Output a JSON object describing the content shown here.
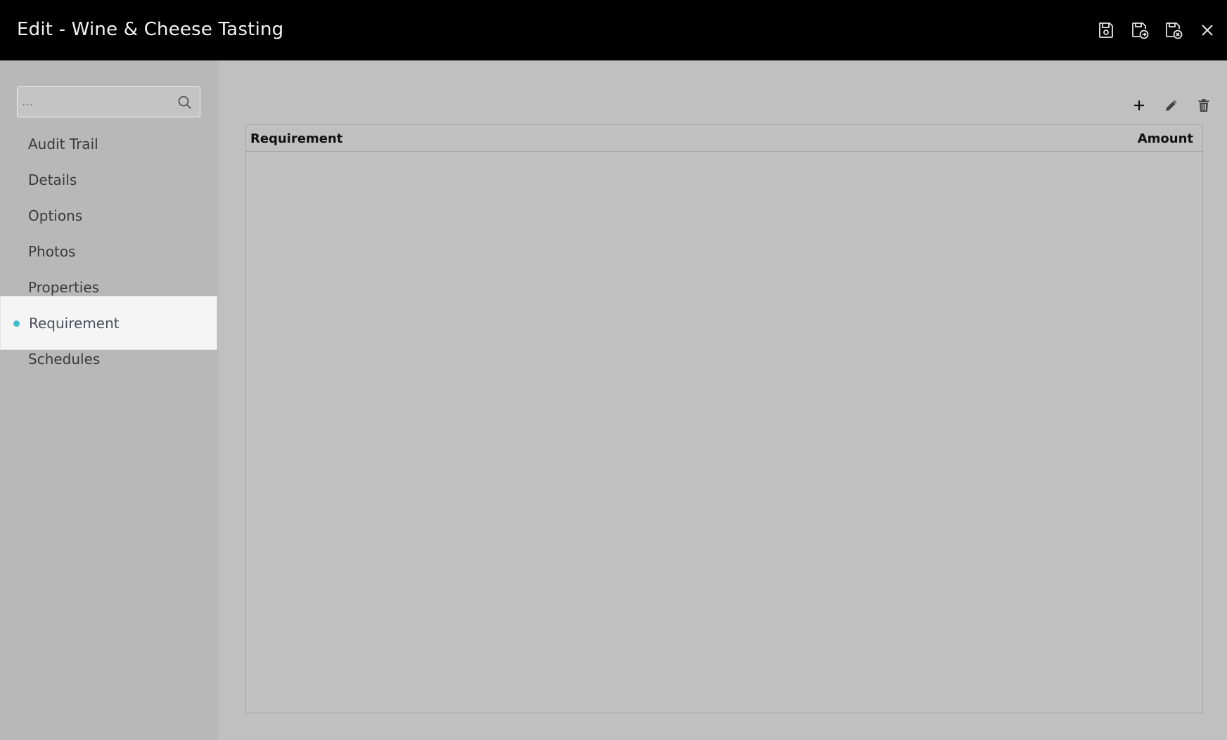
{
  "window": {
    "title": "Edit - Wine & Cheese Tasting"
  },
  "header_actions": [
    {
      "name": "save-icon"
    },
    {
      "name": "save-and-continue-icon"
    },
    {
      "name": "save-and-close-icon"
    },
    {
      "name": "close-icon"
    }
  ],
  "sidebar": {
    "search": {
      "placeholder": "...",
      "value": ""
    },
    "items": [
      {
        "label": "Audit Trail",
        "active": false
      },
      {
        "label": "Details",
        "active": false
      },
      {
        "label": "Options",
        "active": false
      },
      {
        "label": "Photos",
        "active": false
      },
      {
        "label": "Properties",
        "active": false
      },
      {
        "label": "Requirement",
        "active": true
      },
      {
        "label": "Schedules",
        "active": false
      }
    ],
    "active_indicator_color": "#3fbdcc"
  },
  "toolbar": {
    "icons": [
      "plus-icon",
      "pencil-icon",
      "trash-icon"
    ]
  },
  "grid": {
    "columns": [
      "Requirement",
      "Amount"
    ],
    "rows": []
  }
}
